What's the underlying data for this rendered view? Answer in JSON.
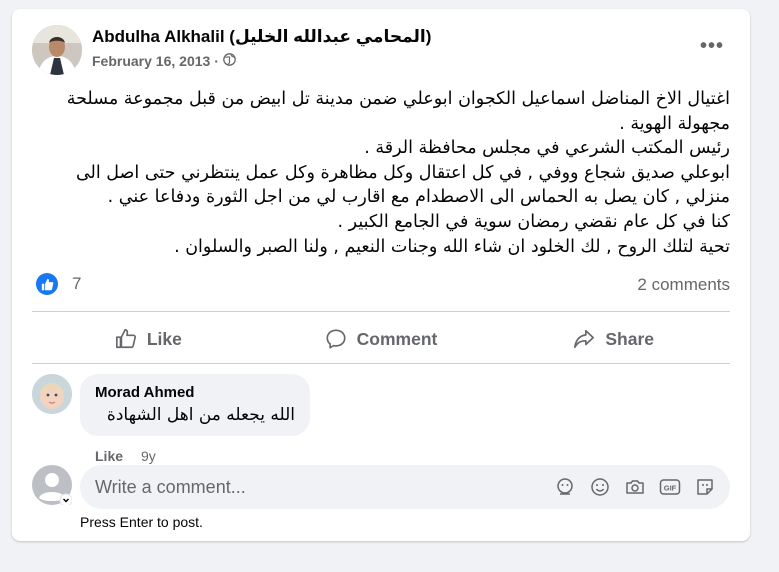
{
  "post": {
    "author": "Abdulha Alkhalil (المحامي عبدالله الخليل)",
    "date": "February 16, 2013",
    "separator": "·",
    "privacy_icon": "globe-icon",
    "more_label": "•••",
    "lines": [
      "اغتيال الاخ المناضل اسماعيل الكجوان ابوعلي ضمن مدينة تل ابيض من قبل مجموعة مسلحة مجهولة الهوية .",
      "رئيس المكتب الشرعي في مجلس محافظة الرقة .",
      "ابوعلي صديق شجاع ووفي , في كل اعتقال وكل مظاهرة وكل عمل ينتظرني حتى اصل الى منزلي , كان يصل به الحماس الى الاصطدام مع اقارب لي من اجل الثورة ودفاعا عني .",
      "كنا في كل عام نقضي رمضان سوية في الجامع الكبير .",
      "تحية لتلك الروح , لك الخلود ان شاء الله وجنات النعيم , ولنا الصبر والسلوان ."
    ]
  },
  "stats": {
    "reaction_count": "7",
    "comments_label": "2 comments",
    "like_color": "#1877f2"
  },
  "actions": {
    "like": "Like",
    "comment": "Comment",
    "share": "Share"
  },
  "comment": {
    "author": "Morad Ahmed",
    "text": "الله يجعله من اهل الشهادة",
    "like_label": "Like",
    "age": "9y"
  },
  "composer": {
    "placeholder": "Write a comment...",
    "hint": "Press Enter to post.",
    "tool_icons": [
      "avatar-sticker-icon",
      "emoji-icon",
      "camera-icon",
      "gif-icon",
      "sticker-icon"
    ]
  }
}
